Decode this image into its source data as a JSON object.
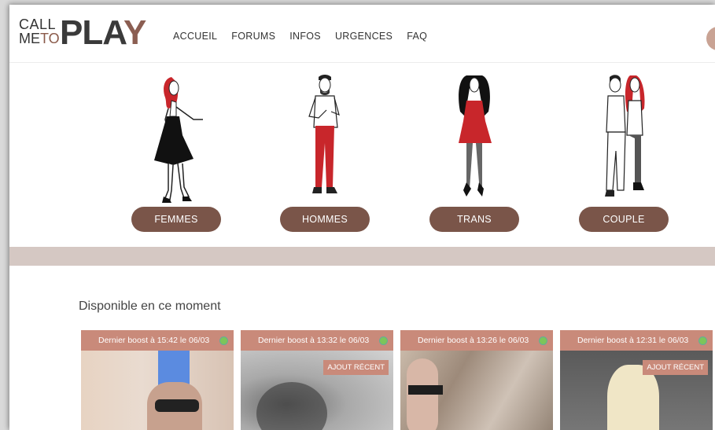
{
  "logo": {
    "call": "CALL",
    "me": "ME",
    "to": "TO",
    "pla": "PLA",
    "y": "Y"
  },
  "nav": [
    "ACCUEIL",
    "FORUMS",
    "INFOS",
    "URGENCES",
    "FAQ"
  ],
  "categories": [
    {
      "label": "FEMMES"
    },
    {
      "label": "HOMMES"
    },
    {
      "label": "TRANS"
    },
    {
      "label": "COUPLE"
    }
  ],
  "available": {
    "title": "Disponible en ce moment",
    "cards": [
      {
        "boost": "Dernier boost à 15:42 le 06/03",
        "badge": ""
      },
      {
        "boost": "Dernier boost à 13:32 le 06/03",
        "badge": "AJOUT RÉCENT"
      },
      {
        "boost": "Dernier boost à 13:26 le 06/03",
        "badge": ""
      },
      {
        "boost": "Dernier boost à 12:31 le 06/03",
        "badge": "AJOUT RÉCENT"
      }
    ]
  },
  "colors": {
    "brand": "#7a5549",
    "accent": "#c98a7a",
    "band": "#d5c8c3",
    "online": "#7cc55a"
  }
}
